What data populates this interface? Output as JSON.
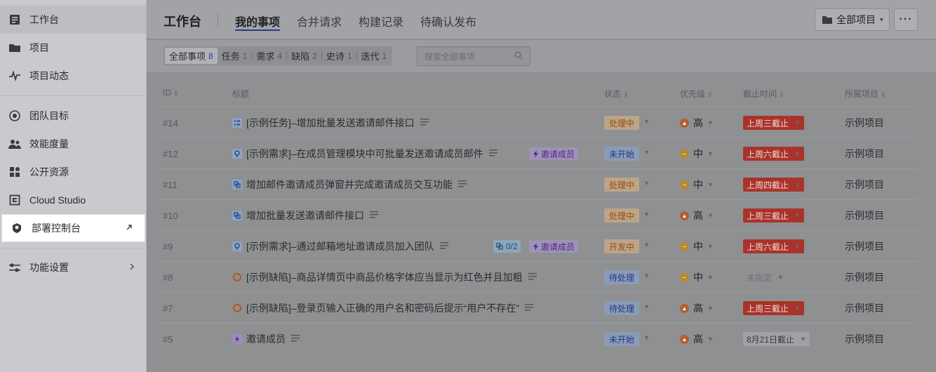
{
  "sidebar": {
    "items": [
      {
        "label": "工作台",
        "icon": "workbench-icon"
      },
      {
        "label": "项目",
        "icon": "folder-icon"
      },
      {
        "label": "项目动态",
        "icon": "activity-icon"
      },
      {
        "label": "团队目标",
        "icon": "target-icon"
      },
      {
        "label": "效能度量",
        "icon": "metrics-icon"
      },
      {
        "label": "公开资源",
        "icon": "resources-icon"
      },
      {
        "label": "Cloud Studio",
        "icon": "cloud-studio-icon"
      },
      {
        "label": "部署控制台",
        "icon": "deploy-icon"
      },
      {
        "label": "功能设置",
        "icon": "settings-icon"
      }
    ]
  },
  "header": {
    "title": "工作台",
    "tabs": [
      "我的事项",
      "合并请求",
      "构建记录",
      "待确认发布"
    ],
    "project_select": "全部项目",
    "more": "···"
  },
  "filters": {
    "items": [
      {
        "label": "全部事项",
        "count": "8"
      },
      {
        "label": "任务",
        "count": "1"
      },
      {
        "label": "需求",
        "count": "4"
      },
      {
        "label": "缺陷",
        "count": "2"
      },
      {
        "label": "史诗",
        "count": "1"
      },
      {
        "label": "迭代",
        "count": "1"
      }
    ],
    "search_placeholder": "搜索全部事项"
  },
  "table": {
    "headers": [
      "ID",
      "标题",
      "状态",
      "优先级",
      "截止时间",
      "所属项目"
    ],
    "rows": [
      {
        "id": "#14",
        "type": "task",
        "title": "[示例任务]–增加批量发送邀请邮件接口",
        "tag": "",
        "sub": "",
        "status": "处理中",
        "status_color": "orange",
        "priority": "高",
        "due": "上周三截止",
        "due_style": "red",
        "project": "示例项目"
      },
      {
        "id": "#12",
        "type": "requirement",
        "title": "[示例需求]–在成员管理模块中可批量发送邀请成员邮件",
        "tag": "邀请成员",
        "sub": "",
        "status": "未开始",
        "status_color": "blue",
        "priority": "中",
        "due": "上周六截止",
        "due_style": "red",
        "project": "示例项目"
      },
      {
        "id": "#11",
        "type": "subtask",
        "title": "增加邮件邀请成员弹窗并完成邀请成员交互功能",
        "tag": "",
        "sub": "",
        "status": "处理中",
        "status_color": "orange",
        "priority": "中",
        "due": "上周四截止",
        "due_style": "red",
        "project": "示例项目"
      },
      {
        "id": "#10",
        "type": "subtask",
        "title": "增加批量发送邀请邮件接口",
        "tag": "",
        "sub": "",
        "status": "处理中",
        "status_color": "orange",
        "priority": "高",
        "due": "上周三截止",
        "due_style": "red",
        "project": "示例项目"
      },
      {
        "id": "#9",
        "type": "requirement",
        "title": "[示例需求]–通过邮箱地址邀请成员加入团队",
        "tag": "邀请成员",
        "sub": "0/2",
        "status": "开发中",
        "status_color": "orange",
        "priority": "中",
        "due": "上周六截止",
        "due_style": "red",
        "project": "示例项目"
      },
      {
        "id": "#8",
        "type": "defect",
        "title": "[示例缺陷]–商品详情页中商品价格字体应当显示为红色并且加粗",
        "tag": "",
        "sub": "",
        "status": "待处理",
        "status_color": "blue",
        "priority": "中",
        "due": "未指定",
        "due_style": "none",
        "project": "示例项目"
      },
      {
        "id": "#7",
        "type": "defect",
        "title": "[示例缺陷]–登录页输入正确的用户名和密码后提示“用户不存在”",
        "tag": "",
        "sub": "",
        "status": "待处理",
        "status_color": "blue",
        "priority": "高",
        "due": "上周三截止",
        "due_style": "red",
        "project": "示例项目"
      },
      {
        "id": "#5",
        "type": "epic",
        "title": "邀请成员",
        "tag": "",
        "sub": "",
        "status": "未开始",
        "status_color": "blue",
        "priority": "高",
        "due": "8月21日截止",
        "due_style": "gray",
        "project": "示例项目"
      }
    ]
  }
}
